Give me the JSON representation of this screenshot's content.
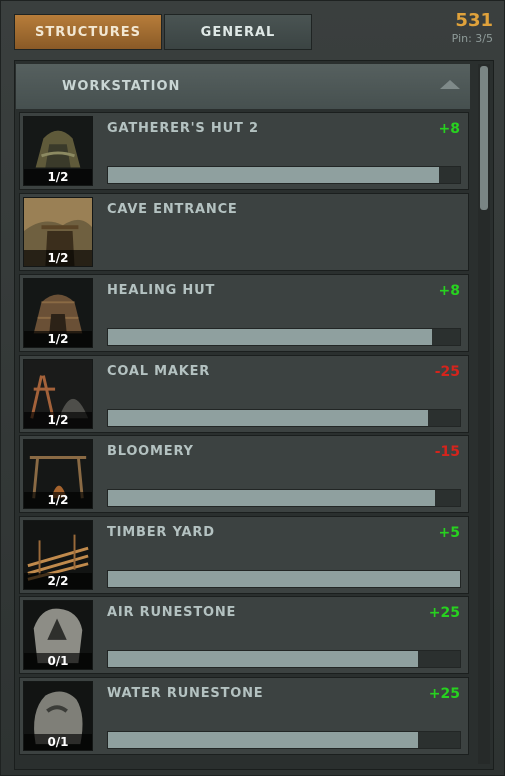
{
  "tabs": [
    {
      "label": "STRUCTURES",
      "active": true
    },
    {
      "label": "GENERAL",
      "active": false
    }
  ],
  "counter": {
    "value": "531",
    "pin": "Pin: 3/5"
  },
  "section": {
    "label": "WORKSTATION"
  },
  "colors": {
    "positive": "#27d21f",
    "negative": "#d5241c"
  },
  "rows": [
    {
      "name": "GATHERER'S HUT 2",
      "count": "1/2",
      "value": "+8",
      "sign": "positive",
      "progress": 0.94,
      "icon": "hut-icon"
    },
    {
      "name": "CAVE ENTRANCE",
      "count": "1/2",
      "value": "",
      "sign": "",
      "progress": null,
      "icon": "cave-icon"
    },
    {
      "name": "HEALING HUT",
      "count": "1/2",
      "value": "+8",
      "sign": "positive",
      "progress": 0.92,
      "icon": "healing-hut-icon"
    },
    {
      "name": "COAL MAKER",
      "count": "1/2",
      "value": "-25",
      "sign": "negative",
      "progress": 0.91,
      "icon": "coal-maker-icon"
    },
    {
      "name": "BLOOMERY",
      "count": "1/2",
      "value": "-15",
      "sign": "negative",
      "progress": 0.93,
      "icon": "bloomery-icon"
    },
    {
      "name": "TIMBER YARD",
      "count": "2/2",
      "value": "+5",
      "sign": "positive",
      "progress": 1.0,
      "icon": "timber-yard-icon"
    },
    {
      "name": "AIR RUNESTONE",
      "count": "0/1",
      "value": "+25",
      "sign": "positive",
      "progress": 0.88,
      "icon": "air-runestone-icon"
    },
    {
      "name": "WATER RUNESTONE",
      "count": "0/1",
      "value": "+25",
      "sign": "positive",
      "progress": 0.88,
      "icon": "water-runestone-icon"
    }
  ]
}
